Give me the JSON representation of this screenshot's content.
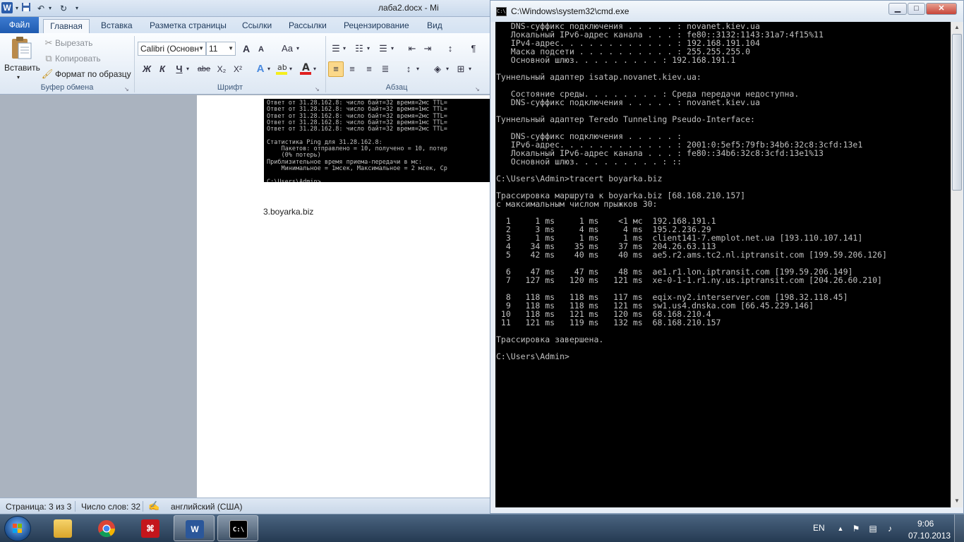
{
  "word": {
    "title": "лаба2.docx - Mi",
    "tabs": [
      "Файл",
      "Главная",
      "Вставка",
      "Разметка страницы",
      "Ссылки",
      "Рассылки",
      "Рецензирование",
      "Вид"
    ],
    "clipboard": {
      "paste_label": "Вставить",
      "cut_label": "Вырезать",
      "copy_label": "Копировать",
      "format_painter_label": "Формат по образцу",
      "group_label": "Буфер обмена"
    },
    "font": {
      "name": "Calibri (Основн",
      "size": "11",
      "group_label": "Шрифт",
      "bold": "Ж",
      "italic": "К",
      "underline": "Ч",
      "strike": "abe",
      "subscript": "X₂",
      "superscript": "X²",
      "grow": "A",
      "shrink": "A",
      "case": "Aa",
      "font_color": "A"
    },
    "paragraph": {
      "group_label": "Абзац",
      "pilcrow": "¶"
    },
    "document": {
      "ping_output": "Ответ от 31.28.162.8: число байт=32 время=2мс TTL=\nОтвет от 31.28.162.8: число байт=32 время=1мс TTL=\nОтвет от 31.28.162.8: число байт=32 время=2мс TTL=\nОтвет от 31.28.162.8: число байт=32 время=1мс TTL=\nОтвет от 31.28.162.8: число байт=32 время=2мс TTL=\n\nСтатистика Ping для 31.28.162.8:\n    Пакетов: отправлено = 10, получено = 10, потер\n    (0% потерь)\nПриблизительное время приема-передачи в мс:\n    Минимальное = 1мсек, Максимальное = 2 мсек, Ср\n\nC:\\Users\\Admin>",
      "heading_text": "3.boyarka.biz"
    },
    "status": {
      "page": "Страница: 3 из 3",
      "words": "Число слов: 32",
      "language": "английский (США)"
    }
  },
  "cmd": {
    "title": "C:\\Windows\\system32\\cmd.exe",
    "console": "   DNS-суффикс подключения . . . . . : novanet.kiev.ua\n   Локальный IPv6-адрес канала . . . : fe80::3132:1143:31a7:4f15%11\n   IPv4-адрес. . . . . . . . . . . . : 192.168.191.104\n   Маска подсети . . . . . . . . . . : 255.255.255.0\n   Основной шлюз. . . . . . . . . : 192.168.191.1\n\nТуннельный адаптер isatap.novanet.kiev.ua:\n\n   Состояние среды. . . . . . . . : Среда передачи недоступна.\n   DNS-суффикс подключения . . . . . : novanet.kiev.ua\n\nТуннельный адаптер Teredo Tunneling Pseudo-Interface:\n\n   DNS-суффикс подключения . . . . . :\n   IPv6-адрес. . . . . . . . . . . . : 2001:0:5ef5:79fb:34b6:32c8:3cfd:13e1\n   Локальный IPv6-адрес канала . . . : fe80::34b6:32c8:3cfd:13e1%13\n   Основной шлюз. . . . . . . . . : ::\n\nC:\\Users\\Admin>tracert boyarka.biz\n\nТрассировка маршрута к boyarka.biz [68.168.210.157]\nс максимальным числом прыжков 30:\n\n  1     1 ms     1 ms    <1 мс  192.168.191.1\n  2     3 ms     4 ms     4 ms  195.2.236.29\n  3     1 ms     1 ms     1 ms  client141-7.emplot.net.ua [193.110.107.141]\n  4    34 ms    35 ms    37 ms  204.26.63.113\n  5    42 ms    40 ms    40 ms  ae5.r2.ams.tc2.nl.iptransit.com [199.59.206.126]\n\n  6    47 ms    47 ms    48 ms  ae1.r1.lon.iptransit.com [199.59.206.149]\n  7   127 ms   120 ms   121 ms  xe-0-1-1.r1.ny.us.iptransit.com [204.26.60.210]\n\n  8   118 ms   118 ms   117 ms  eqix-ny2.interserver.com [198.32.118.45]\n  9   118 ms   118 ms   121 ms  sw1.us4.dnska.com [66.45.229.146]\n 10   118 ms   121 ms   120 ms  68.168.210.4\n 11   121 ms   119 ms   132 ms  68.168.210.157\n\nТрассировка завершена.\n\nC:\\Users\\Admin>"
  },
  "taskbar": {
    "language": "EN",
    "time": "9:06",
    "date": "07.10.2013",
    "items": [
      "explorer",
      "chrome",
      "acrobat",
      "word",
      "cmd"
    ]
  }
}
